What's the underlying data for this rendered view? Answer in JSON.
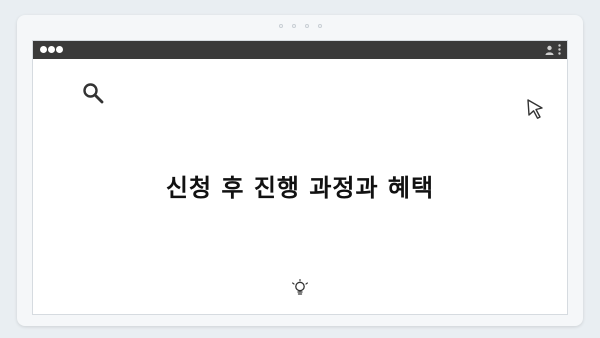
{
  "heading": "신청 후 진행 과정과 혜택",
  "icons": {
    "search": "search-icon",
    "cursor": "cursor-icon",
    "bulb": "lightbulb-icon",
    "user": "user-icon",
    "menu": "more-vertical-icon"
  },
  "colors": {
    "titlebar": "#3a3a3a",
    "background": "#e9eef2",
    "heading": "#111111"
  }
}
